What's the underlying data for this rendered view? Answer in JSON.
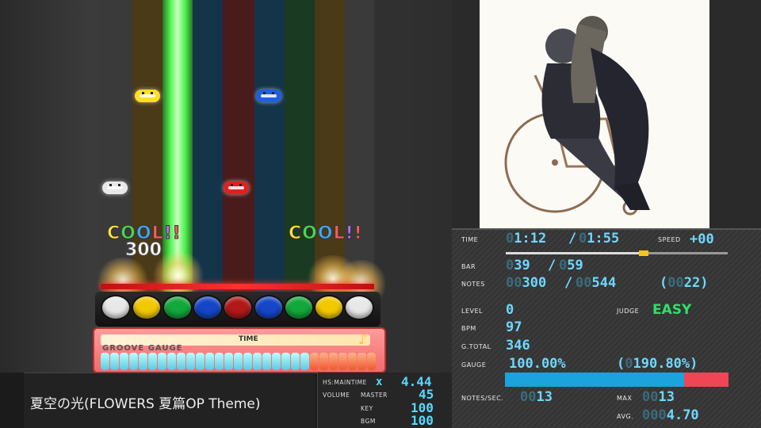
{
  "colors": {
    "accent": "#6fd8ff",
    "easy": "#2ee06a",
    "gauge_blue": "#1aa3dd",
    "gauge_red": "#f04555"
  },
  "playfield": {
    "judgements": [
      {
        "letters": [
          "C",
          "O",
          "O",
          "L",
          "!",
          "!"
        ]
      },
      {
        "letters": [
          "C",
          "O",
          "O",
          "L",
          "!",
          "!"
        ]
      }
    ],
    "combo": "300",
    "groove_gauge_label": "GROOVE GAUGE",
    "time_label": "TIME",
    "gauge_level": 0.77,
    "note_icon": "music-note-icon"
  },
  "song": {
    "title": "夏空の光(FLOWERS 夏篇OP Theme)"
  },
  "info": {
    "hs_maintime_label": "HS:MAINTIME",
    "x_mark": "x",
    "hs_value": "4.44",
    "volume_label": "VOLUME",
    "master_label": "MASTER",
    "master_value": "45",
    "key_label": "KEY",
    "key_value": "100",
    "bgm_label": "BGM",
    "bgm_value": "100"
  },
  "stats": {
    "time_label": "TIME",
    "time_current": "1:12",
    "time_separator": "/",
    "time_total": "1:55",
    "speed_label": "SPEED",
    "speed_value": "+00",
    "progress": 0.62,
    "bar_label": "BAR",
    "bar_current": "39",
    "bar_separator": "/",
    "bar_total": "59",
    "notes_label": "NOTES",
    "notes_current": "300",
    "notes_separator": "/",
    "notes_total": "544",
    "notes_extra": "22",
    "level_label": "LEVEL",
    "level_value": "0",
    "judge_label": "JUDGE",
    "judge_value": "EASY",
    "bpm_label": "BPM",
    "bpm_value": "97",
    "gtotal_label": "G.TOTAL",
    "gtotal_value": "346",
    "gauge_label": "GAUGE",
    "gauge_value": "100.00%",
    "gauge_extra": "190.80%",
    "gauge_fill": 0.8,
    "nps_label": "NOTES/SEC.",
    "nps_value": "13",
    "max_label": "MAX",
    "max_value": "13",
    "avg_label": "AVG.",
    "avg_value": "4.70"
  }
}
